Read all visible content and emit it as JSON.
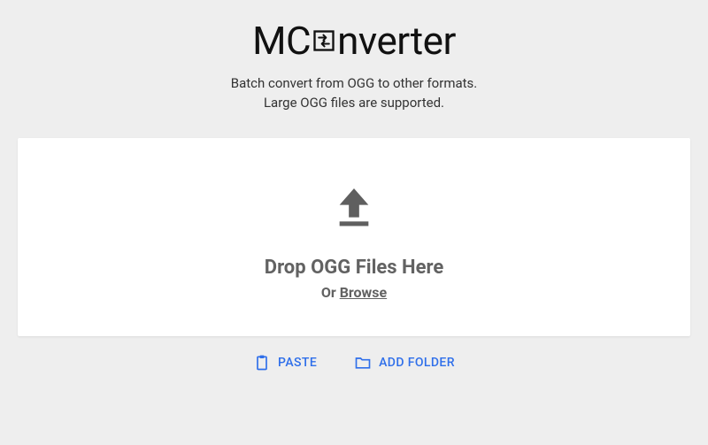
{
  "logo": {
    "left": "MC",
    "right": "nverter"
  },
  "subtitle": {
    "line1": "Batch convert from OGG to other formats.",
    "line2": "Large OGG files are supported."
  },
  "dropzone": {
    "title": "Drop OGG Files Here",
    "or": "Or ",
    "browse": "Browse"
  },
  "actions": {
    "paste": "PASTE",
    "add_folder": "ADD FOLDER"
  }
}
